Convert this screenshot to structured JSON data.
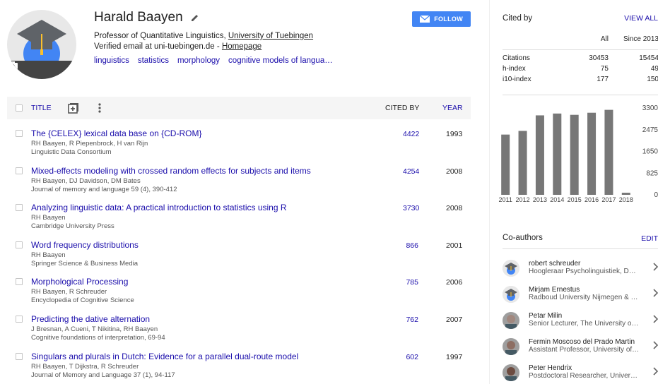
{
  "profile": {
    "name": "Harald Baayen",
    "title": "Professor of Quantitative Linguistics,",
    "university": "University of Tuebingen",
    "email_text": "Verified email at uni-tuebingen.de -",
    "homepage": "Homepage",
    "interests": [
      "linguistics",
      "statistics",
      "morphology",
      "cognitive models of langua…"
    ],
    "follow_label": "FOLLOW"
  },
  "table": {
    "title_header": "TITLE",
    "cited_header": "CITED BY",
    "year_header": "YEAR",
    "rows": [
      {
        "title": "The {CELEX} lexical data base on {CD-ROM}",
        "authors": "RH Baayen, R Piepenbrock, H van Rijn",
        "venue": "Linguistic Data Consortium",
        "cited": "4422",
        "year": "1993"
      },
      {
        "title": "Mixed-effects modeling with crossed random effects for subjects and items",
        "authors": "RH Baayen, DJ Davidson, DM Bates",
        "venue": "Journal of memory and language 59 (4), 390-412",
        "cited": "4254",
        "year": "2008"
      },
      {
        "title": "Analyzing linguistic data: A practical introduction to statistics using R",
        "authors": "RH Baayen",
        "venue": "Cambridge University Press",
        "cited": "3730",
        "year": "2008"
      },
      {
        "title": "Word frequency distributions",
        "authors": "RH Baayen",
        "venue": "Springer Science & Business Media",
        "cited": "866",
        "year": "2001"
      },
      {
        "title": "Morphological Processing",
        "authors": "RH Baayen, R Schreuder",
        "venue": "Encyclopedia of Cognitive Science",
        "cited": "785",
        "year": "2006"
      },
      {
        "title": "Predicting the dative alternation",
        "authors": "J Bresnan, A Cueni, T Nikitina, RH Baayen",
        "venue": "Cognitive foundations of interpretation, 69-94",
        "cited": "762",
        "year": "2007"
      },
      {
        "title": "Singulars and plurals in Dutch: Evidence for a parallel dual-route model",
        "authors": "RH Baayen, T Dijkstra, R Schreuder",
        "venue": "Journal of Memory and Language 37 (1), 94-117",
        "cited": "602",
        "year": "1997"
      }
    ]
  },
  "cited_by": {
    "title": "Cited by",
    "view_all": "VIEW ALL",
    "col_all": "All",
    "col_since": "Since 2013",
    "rows": [
      {
        "label": "Citations",
        "all": "30453",
        "since": "15454"
      },
      {
        "label": "h-index",
        "all": "75",
        "since": "49"
      },
      {
        "label": "i10-index",
        "all": "177",
        "since": "150"
      }
    ]
  },
  "chart_data": {
    "type": "bar",
    "categories": [
      "2011",
      "2012",
      "2013",
      "2014",
      "2015",
      "2016",
      "2017",
      "2018"
    ],
    "values": [
      2290,
      2430,
      3020,
      3090,
      3040,
      3120,
      3230,
      80
    ],
    "yticks": [
      "0",
      "825",
      "1650",
      "2475",
      "3300"
    ],
    "ylim": [
      0,
      3300
    ],
    "bar_color": "#777777"
  },
  "coauthors": {
    "title": "Co-authors",
    "edit": "EDIT",
    "items": [
      {
        "name": "robert schreuder",
        "affil": "Hoogleraar Psycholinguistiek, D…",
        "avatar": "placeholder"
      },
      {
        "name": "Mirjam Ernestus",
        "affil": "Radboud University Nijmegen & …",
        "avatar": "placeholder"
      },
      {
        "name": "Petar Milin",
        "affil": "Senior Lecturer, The University o…",
        "avatar": "photo"
      },
      {
        "name": "Fermin Moscoso del Prado Martin",
        "affil": "Assistant Professor, University of…",
        "avatar": "photo"
      },
      {
        "name": "Peter Hendrix",
        "affil": "Postdoctoral Researcher, Univer…",
        "avatar": "photo"
      }
    ]
  }
}
